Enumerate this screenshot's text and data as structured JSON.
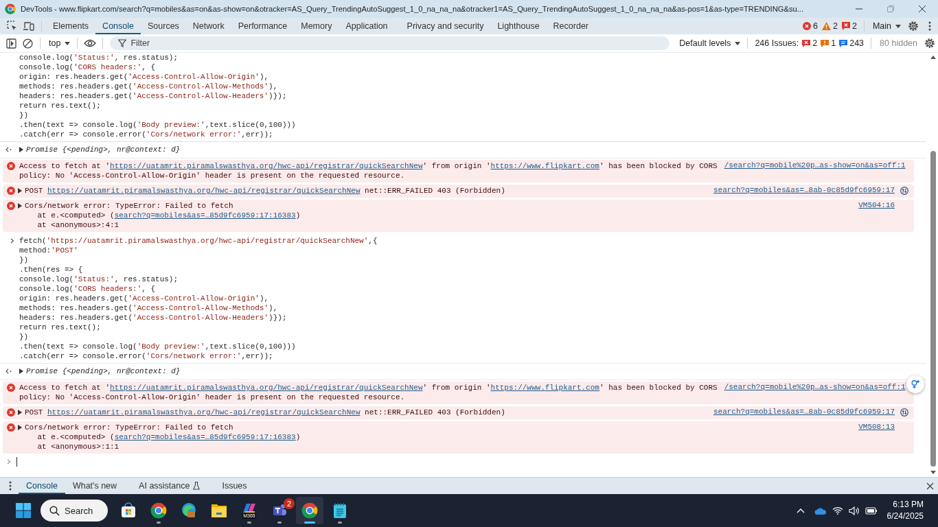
{
  "window": {
    "title": "DevTools - www.flipkart.com/search?q=mobiles&as=on&as-show=on&otracker=AS_Query_TrendingAutoSuggest_1_0_na_na_na&otracker1=AS_Query_TrendingAutoSuggest_1_0_na_na_na&as-pos=1&as-type=TRENDING&su..."
  },
  "tabs": [
    {
      "label": "Elements",
      "selected": false
    },
    {
      "label": "Console",
      "selected": true
    },
    {
      "label": "Sources",
      "selected": false
    },
    {
      "label": "Network",
      "selected": false
    },
    {
      "label": "Performance",
      "selected": false
    },
    {
      "label": "Memory",
      "selected": false
    },
    {
      "label": "Application",
      "selected": false
    },
    {
      "label": "Privacy and security",
      "selected": false
    },
    {
      "label": "Lighthouse",
      "selected": false
    },
    {
      "label": "Recorder",
      "selected": false
    }
  ],
  "counts": [
    {
      "kind": "error",
      "count": "6"
    },
    {
      "kind": "warning",
      "count": "2"
    },
    {
      "kind": "issue",
      "count": "2"
    }
  ],
  "target": "Main",
  "toolbar": {
    "context": "top",
    "filter_placeholder": "Filter",
    "levels": "Default levels",
    "issues_label": "246 Issues:",
    "hidden": "80 hidden",
    "issue_counts": [
      {
        "kind": "issue",
        "count": "2"
      },
      {
        "kind": "warning",
        "count": "1"
      },
      {
        "kind": "info",
        "count": "243"
      }
    ]
  },
  "console": [
    {
      "kind": "input",
      "lines": [
        "console.log('Status:', res.status);",
        "console.log('CORS headers:', {",
        "origin: res.headers.get('Access-Control-Allow-Origin'),",
        "methods: res.headers.get('Access-Control-Allow-Methods'),",
        "headers: res.headers.get('Access-Control-Allow-Headers')});",
        "return res.text();",
        "})",
        ".then(text => console.log('Body preview:',text.slice(0,100)))",
        ".catch(err => console.error('Cors/network error:',err));"
      ]
    },
    {
      "kind": "result",
      "text": "Promise {<pending>, nr@context: d}"
    },
    {
      "kind": "error",
      "expandable": false,
      "network": false,
      "source": "/search?q=mobile%20p…as-show=on&as=off:1",
      "lines": [
        [
          {
            "text": "Access to fetch at '"
          },
          {
            "text": "https://uatamrit.piramalswasthya.org/hwc-api/registrar/quickSearchNew",
            "link": true
          },
          {
            "text": "' from origin '"
          },
          {
            "text": "https://www.flipkart.com",
            "link": true
          },
          {
            "text": "' has been blocked by CORS"
          }
        ],
        [
          {
            "text": "policy: No 'Access-Control-Allow-Origin' header is present on the requested resource."
          }
        ]
      ]
    },
    {
      "kind": "error",
      "expandable": true,
      "network": true,
      "source": "search?q=mobiles&as=…8ab-0c85d9fc6959:17",
      "lines": [
        [
          {
            "text": "POST "
          },
          {
            "text": "https://uatamrit.piramalswasthya.org/hwc-api/registrar/quickSearchNew",
            "link": true
          },
          {
            "text": " net::ERR_FAILED 403 (Forbidden)"
          }
        ]
      ]
    },
    {
      "kind": "error",
      "expandable": true,
      "network": false,
      "source": "VM504:16",
      "lines": [
        [
          {
            "text": "Cors/network error: TypeError: Failed to fetch"
          }
        ],
        [
          {
            "text": "    at e.<computed> ("
          },
          {
            "text": "search?q=mobiles&as=…85d9fc6959:17:16383",
            "link": true
          },
          {
            "text": ")"
          }
        ],
        [
          {
            "text": "    at <anonymous>:4:1"
          }
        ]
      ]
    },
    {
      "kind": "input",
      "lines": [
        "fetch('https://uatamrit.piramalswasthya.org/hwc-api/registrar/quickSearchNew',{",
        "method:'POST'",
        "})",
        ".then(res => {",
        "console.log('Status:', res.status);",
        "console.log('CORS headers:', {",
        "origin: res.headers.get('Access-Control-Allow-Origin'),",
        "methods: res.headers.get('Access-Control-Allow-Methods'),",
        "headers: res.headers.get('Access-Control-Allow-Headers')});",
        "return res.text();",
        "})",
        ".then(text => console.log('Body preview:',text.slice(0,100)))",
        ".catch(err => console.error('Cors/network error:',err));"
      ]
    },
    {
      "kind": "result",
      "text": "Promise {<pending>, nr@context: d}"
    },
    {
      "kind": "error",
      "expandable": false,
      "network": false,
      "source": "/search?q=mobile%20p…as-show=on&as=off:1",
      "lines": [
        [
          {
            "text": "Access to fetch at '"
          },
          {
            "text": "https://uatamrit.piramalswasthya.org/hwc-api/registrar/quickSearchNew",
            "link": true
          },
          {
            "text": "' from origin '"
          },
          {
            "text": "https://www.flipkart.com",
            "link": true
          },
          {
            "text": "' has been blocked by CORS"
          }
        ],
        [
          {
            "text": "policy: No 'Access-Control-Allow-Origin' header is present on the requested resource."
          }
        ]
      ]
    },
    {
      "kind": "error",
      "expandable": true,
      "network": true,
      "source": "search?q=mobiles&as=…8ab-0c85d9fc6959:17",
      "lines": [
        [
          {
            "text": "POST "
          },
          {
            "text": "https://uatamrit.piramalswasthya.org/hwc-api/registrar/quickSearchNew",
            "link": true
          },
          {
            "text": " net::ERR_FAILED 403 (Forbidden)"
          }
        ]
      ]
    },
    {
      "kind": "error",
      "expandable": true,
      "network": false,
      "source": "VM508:13",
      "lines": [
        [
          {
            "text": "Cors/network error: TypeError: Failed to fetch"
          }
        ],
        [
          {
            "text": "    at e.<computed> ("
          },
          {
            "text": "search?q=mobiles&as=…85d9fc6959:17:16383",
            "link": true
          },
          {
            "text": ")"
          }
        ],
        [
          {
            "text": "    at <anonymous>:1:1"
          }
        ]
      ]
    },
    {
      "kind": "prompt"
    }
  ],
  "drawer_tabs": [
    {
      "label": "Console",
      "selected": true,
      "experimental": false
    },
    {
      "label": "What's new",
      "selected": false,
      "experimental": false
    },
    {
      "label": "AI assistance",
      "selected": false,
      "experimental": true
    },
    {
      "label": "Issues",
      "selected": false,
      "experimental": false
    }
  ],
  "taskbar": {
    "search": "Search",
    "time": "6:13 PM",
    "date": "6/24/2025",
    "apps": [
      {
        "kind": "store",
        "running": false,
        "selected": false
      },
      {
        "kind": "chrome",
        "running": true,
        "selected": false
      },
      {
        "kind": "edge",
        "running": false,
        "selected": false
      },
      {
        "kind": "files",
        "running": false,
        "selected": false
      },
      {
        "kind": "m365",
        "label": "M365",
        "running": true,
        "selected": false
      },
      {
        "kind": "teams",
        "badge": "2",
        "running": true,
        "selected": false
      },
      {
        "kind": "chrome",
        "running": true,
        "selected": true
      },
      {
        "kind": "notepad",
        "running": true,
        "selected": false
      }
    ]
  }
}
